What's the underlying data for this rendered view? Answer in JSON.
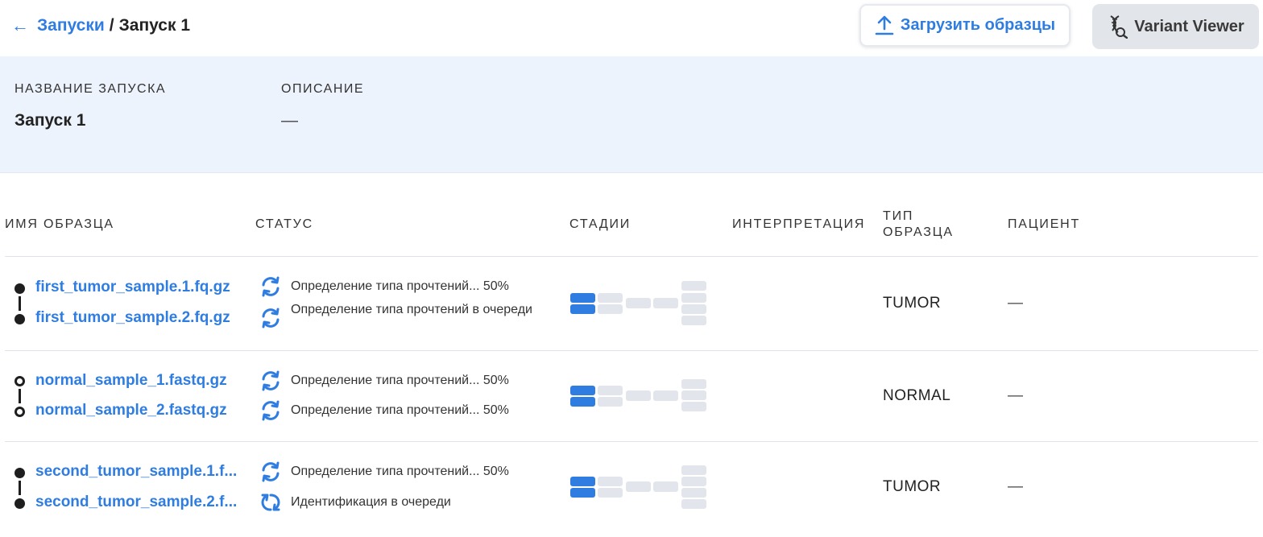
{
  "breadcrumb": {
    "back_icon": "arrow-left-icon",
    "parent": "Запуски",
    "separator": "/",
    "current": "Запуск 1"
  },
  "header_buttons": {
    "upload": {
      "label": "Загрузить образцы",
      "icon": "upload-icon"
    },
    "variant_viewer": {
      "label": "Variant Viewer",
      "icon": "dna-search-icon"
    }
  },
  "run_info": {
    "name_label": "НАЗВАНИЕ ЗАПУСКА",
    "name_value": "Запуск 1",
    "description_label": "ОПИСАНИЕ",
    "description_value": "—"
  },
  "table": {
    "columns": {
      "sample_name": "ИМЯ ОБРАЗЦА",
      "status": "СТАТУС",
      "stages": "СТАДИИ",
      "interpretation": "ИНТЕРПРЕТАЦИЯ",
      "sample_type_line1": "ТИП",
      "sample_type_line2": "ОБРАЗЦА",
      "patient": "ПАЦИЕНТ"
    },
    "rows": [
      {
        "marker": "filled",
        "files": [
          {
            "name": "first_tumor_sample.1.fq.gz",
            "status": "Определение типа прочтений... 50%",
            "status_icon": "sync-icon"
          },
          {
            "name": "first_tumor_sample.2.fq.gz",
            "status": "Определение типа прочтений в очереди",
            "status_icon": "sync-icon"
          }
        ],
        "interpretation": "",
        "sample_type": "TUMOR",
        "patient": "—"
      },
      {
        "marker": "hollow",
        "files": [
          {
            "name": "normal_sample_1.fastq.gz",
            "status": "Определение типа прочтений... 50%",
            "status_icon": "sync-icon"
          },
          {
            "name": "normal_sample_2.fastq.gz",
            "status": "Определение типа прочтений... 50%",
            "status_icon": "sync-icon"
          }
        ],
        "interpretation": "",
        "sample_type": "NORMAL",
        "patient": "—"
      },
      {
        "marker": "filled",
        "files": [
          {
            "name": "second_tumor_sample.1.f...",
            "status": "Определение типа прочтений... 50%",
            "status_icon": "sync-icon"
          },
          {
            "name": "second_tumor_sample.2.f...",
            "status": "Идентификация в очереди",
            "status_icon": "queue-sync-icon"
          }
        ],
        "interpretation": "",
        "sample_type": "TUMOR",
        "patient": "—"
      }
    ]
  },
  "colors": {
    "accent": "#2f7de1",
    "info_bg": "#edf3fd",
    "stage_pending": "#e2e5ec"
  }
}
